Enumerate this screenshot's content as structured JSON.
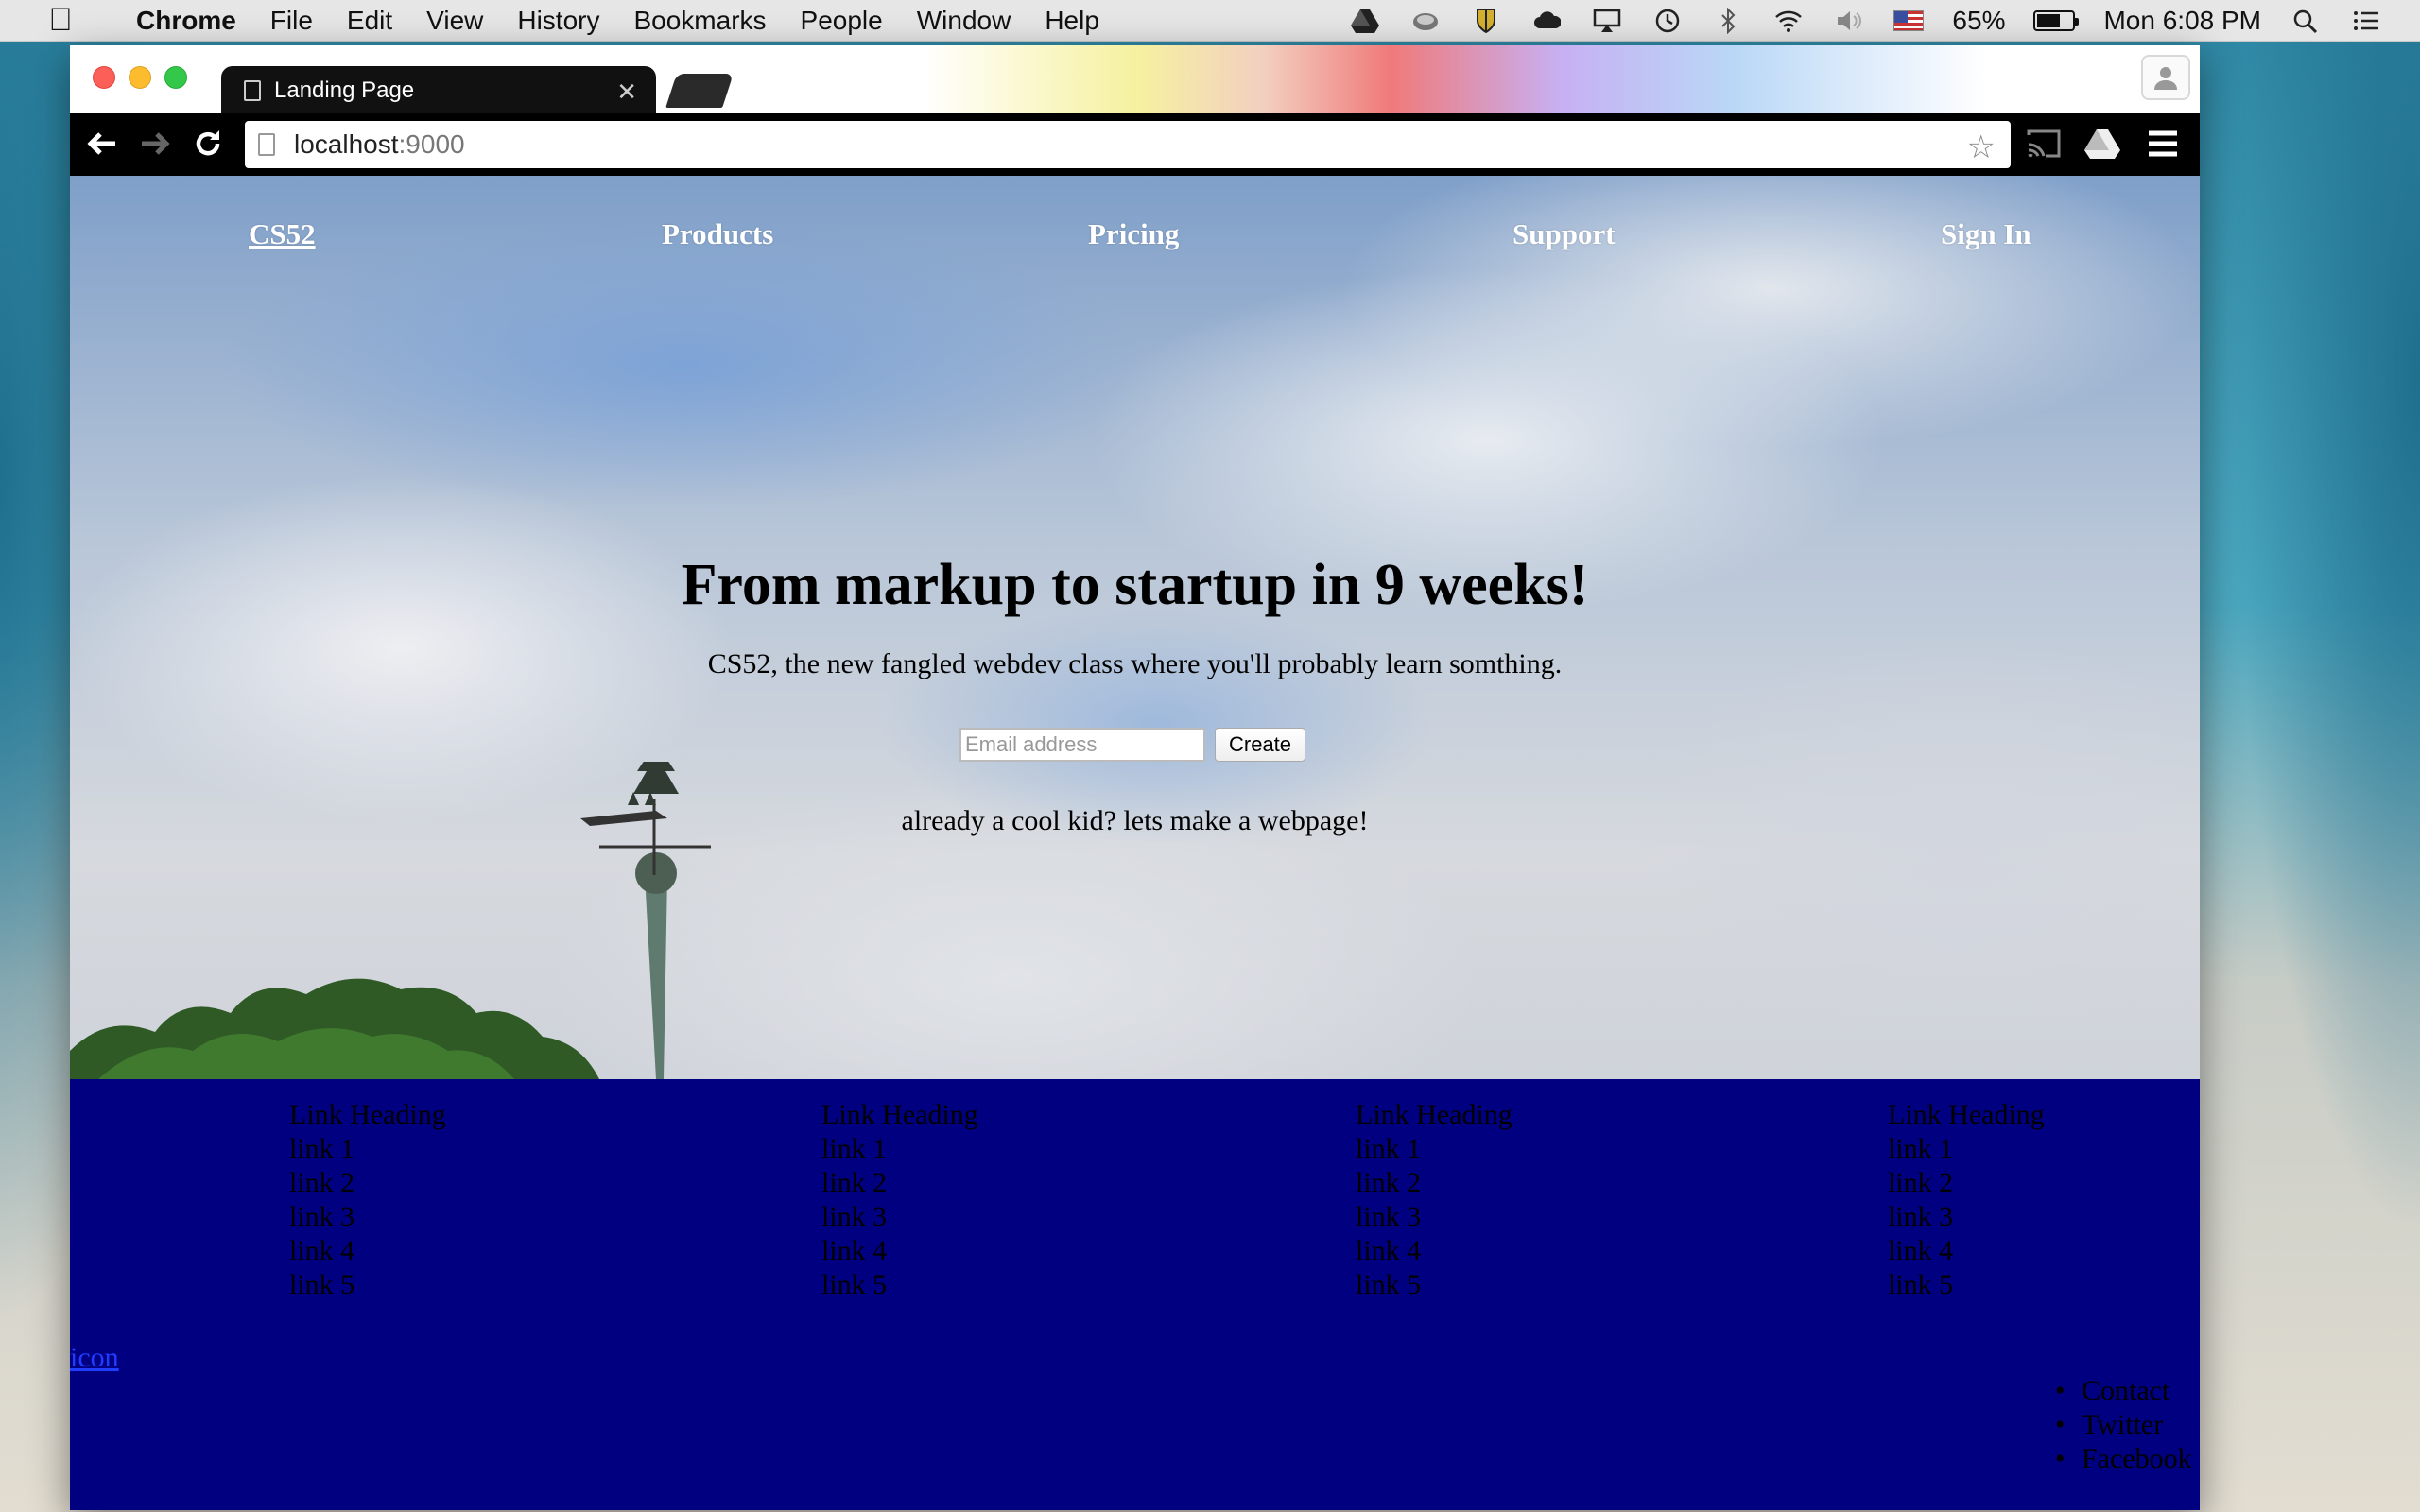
{
  "menubar": {
    "app_name": "Chrome",
    "items": [
      "File",
      "Edit",
      "View",
      "History",
      "Bookmarks",
      "People",
      "Window",
      "Help"
    ],
    "battery_percent": "65%",
    "battery_level": 0.65,
    "clock": "Mon 6:08 PM"
  },
  "browser": {
    "tab_title": "Landing Page",
    "url_host": "localhost",
    "url_port": ":9000"
  },
  "page": {
    "nav": {
      "brand": "CS52",
      "products": "Products",
      "pricing": "Pricing",
      "support": "Support",
      "sign_in": "Sign In"
    },
    "hero": {
      "title": "From markup to startup in 9 weeks!",
      "subtitle": "CS52, the new fangled webdev class where you'll probably learn somthing.",
      "email_placeholder": "Email address",
      "create_label": "Create",
      "cta": "already a cool kid? lets make a webpage!"
    },
    "footer": {
      "columns": [
        {
          "heading": "Link Heading",
          "links": [
            "link 1",
            "link 2",
            "link 3",
            "link 4",
            "link 5"
          ]
        },
        {
          "heading": "Link Heading",
          "links": [
            "link 1",
            "link 2",
            "link 3",
            "link 4",
            "link 5"
          ]
        },
        {
          "heading": "Link Heading",
          "links": [
            "link 1",
            "link 2",
            "link 3",
            "link 4",
            "link 5"
          ]
        },
        {
          "heading": "Link Heading",
          "links": [
            "link 1",
            "link 2",
            "link 3",
            "link 4",
            "link 5"
          ]
        }
      ],
      "icon_link": "icon",
      "social": [
        "Contact",
        "Twitter",
        "Facebook"
      ]
    }
  },
  "colors": {
    "footer_bg": "#000080",
    "nav_text": "#ffffff",
    "icon_link": "#1f3cff"
  }
}
